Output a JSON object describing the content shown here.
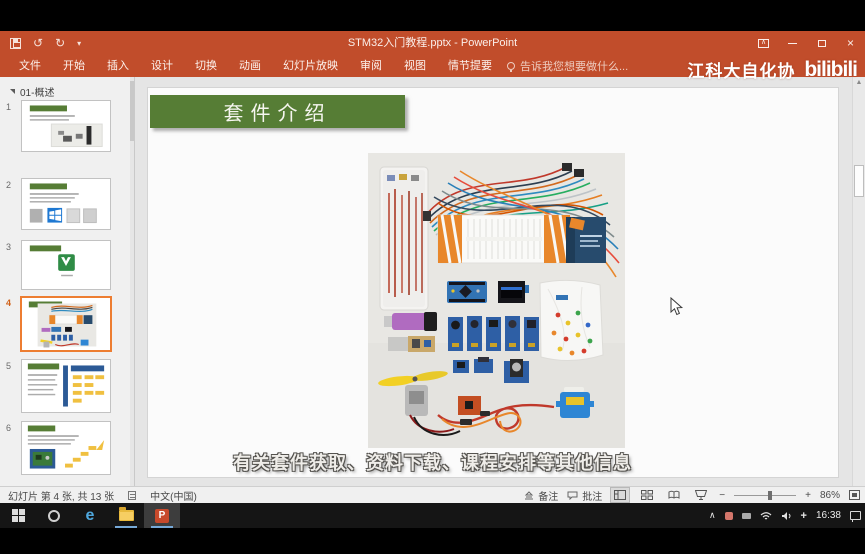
{
  "titlebar": {
    "title": "STM32入门教程.pptx - PowerPoint"
  },
  "ribbon": {
    "tabs": [
      "文件",
      "开始",
      "插入",
      "设计",
      "切换",
      "动画",
      "幻灯片放映",
      "审阅",
      "视图",
      "情节提要"
    ],
    "tell_me": "告诉我您想要做什么..."
  },
  "watermark": {
    "channel": "江科大自化协",
    "logo_text": "bilibili"
  },
  "slide_panel": {
    "section_title": "01-概述",
    "slide_numbers": [
      "1",
      "2",
      "3",
      "4",
      "5",
      "6"
    ],
    "selected_slide_number": "4"
  },
  "slide": {
    "title": "套件介绍"
  },
  "subtitle_overlay": {
    "text": "有关套件获取、资料下载、课程安排等其他信息"
  },
  "statusbar": {
    "slide_info": "幻灯片 第 4 张, 共 13 张",
    "language": "中文(中国)",
    "notes_label": "备注",
    "comments_label": "批注",
    "zoom_minus": "−",
    "zoom_plus": "+",
    "zoom_level": "86%"
  },
  "taskbar": {
    "time": "16:38"
  },
  "icons": {
    "undo": "↺",
    "redo": "↻",
    "dropdown": "▾",
    "scroll_up": "▲",
    "tray_chevron": "∧",
    "tray_plus": "+"
  },
  "colors": {
    "powerpoint_orange": "#C14D2B",
    "slide_title_green": "#567D35",
    "selection_orange": "#ED7D31"
  }
}
